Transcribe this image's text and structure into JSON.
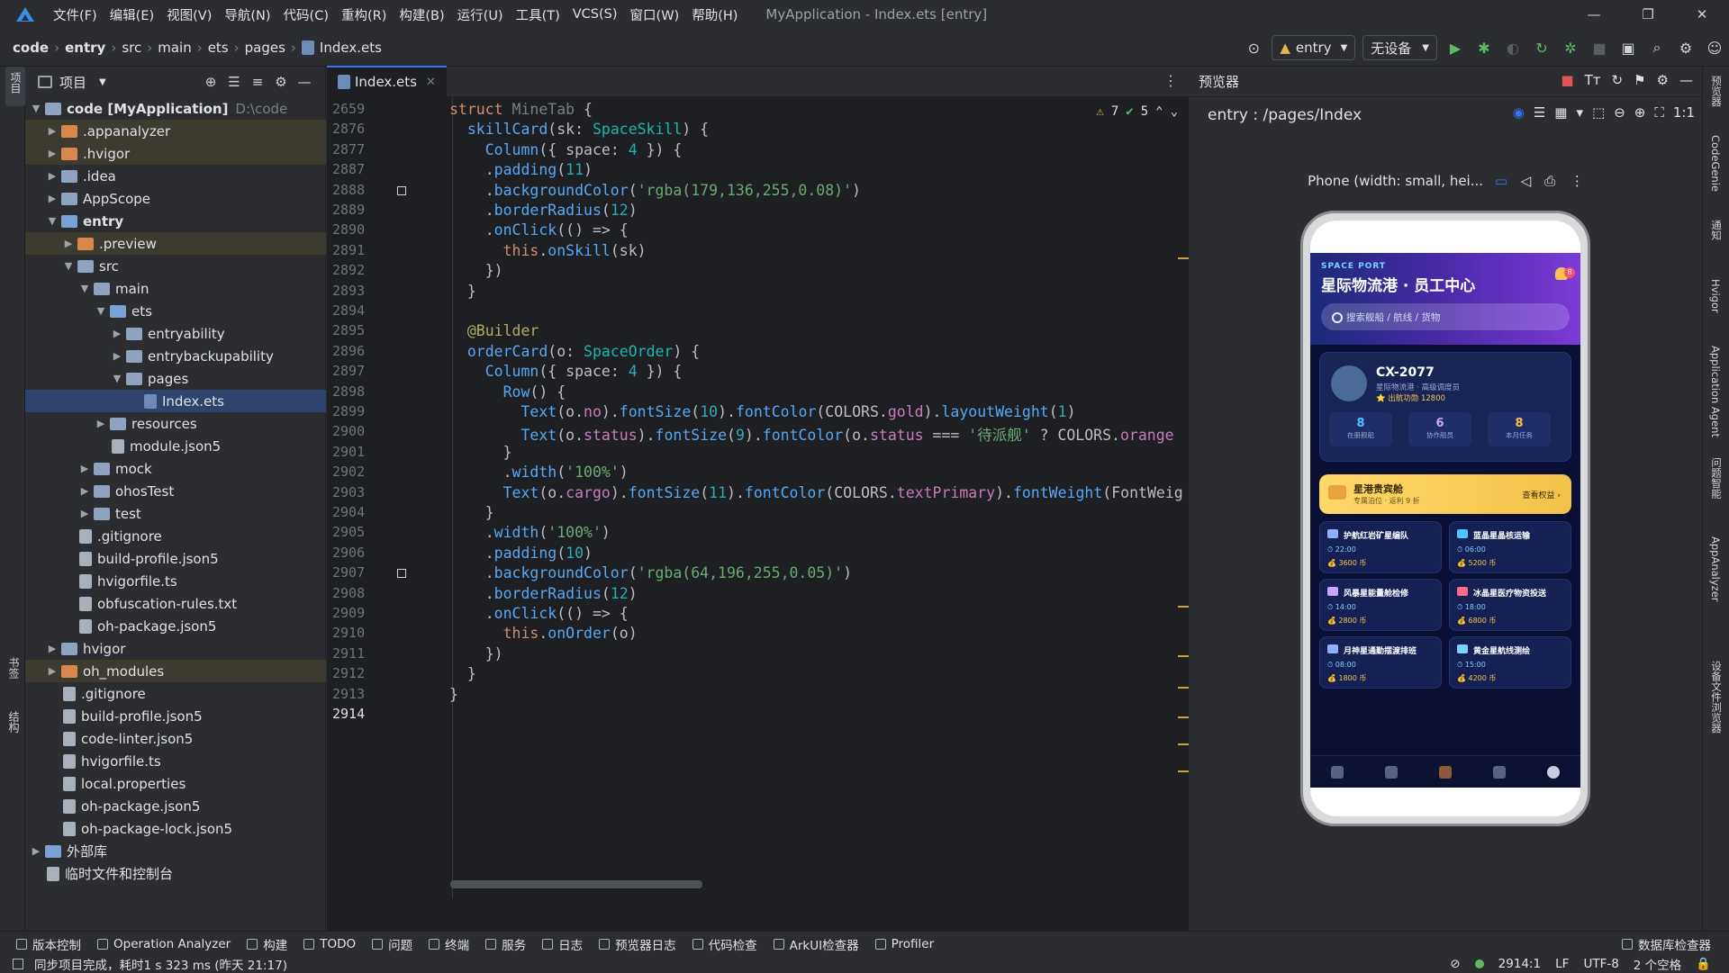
{
  "menubar": {
    "items": [
      "文件(F)",
      "编辑(E)",
      "视图(V)",
      "导航(N)",
      "代码(C)",
      "重构(R)",
      "构建(B)",
      "运行(U)",
      "工具(T)",
      "VCS(S)",
      "窗口(W)",
      "帮助(H)"
    ],
    "window_title": "MyApplication - Index.ets [entry]"
  },
  "breadcrumb": [
    "code",
    "entry",
    "src",
    "main",
    "ets",
    "pages",
    "Index.ets"
  ],
  "toolbar": {
    "module": "entry",
    "device": "无设备"
  },
  "left_tools": {
    "project": "项目",
    "bookmarks": "书签",
    "structure": "结构"
  },
  "project_panel": {
    "title": "项目",
    "tree": [
      {
        "label": "code [MyApplication]",
        "extra": "D:\\code",
        "depth": 0,
        "type": "folder",
        "expanded": true
      },
      {
        "label": ".appanalyzer",
        "depth": 1,
        "type": "folder-orange"
      },
      {
        "label": ".hvigor",
        "depth": 1,
        "type": "folder-orange"
      },
      {
        "label": ".idea",
        "depth": 1,
        "type": "folder"
      },
      {
        "label": "AppScope",
        "depth": 1,
        "type": "folder"
      },
      {
        "label": "entry",
        "depth": 1,
        "type": "folder-blue",
        "expanded": true
      },
      {
        "label": ".preview",
        "depth": 2,
        "type": "folder-orange"
      },
      {
        "label": "src",
        "depth": 2,
        "type": "folder",
        "expanded": true
      },
      {
        "label": "main",
        "depth": 3,
        "type": "folder",
        "expanded": true
      },
      {
        "label": "ets",
        "depth": 4,
        "type": "folder-blue",
        "expanded": true
      },
      {
        "label": "entryability",
        "depth": 5,
        "type": "folder"
      },
      {
        "label": "entrybackupability",
        "depth": 5,
        "type": "folder"
      },
      {
        "label": "pages",
        "depth": 5,
        "type": "folder",
        "expanded": true
      },
      {
        "label": "Index.ets",
        "depth": 6,
        "type": "file-ts",
        "selected": true
      },
      {
        "label": "resources",
        "depth": 4,
        "type": "folder"
      },
      {
        "label": "module.json5",
        "depth": 4,
        "type": "file"
      },
      {
        "label": "mock",
        "depth": 3,
        "type": "folder"
      },
      {
        "label": "ohosTest",
        "depth": 3,
        "type": "folder"
      },
      {
        "label": "test",
        "depth": 3,
        "type": "folder"
      },
      {
        "label": ".gitignore",
        "depth": 2,
        "type": "file"
      },
      {
        "label": "build-profile.json5",
        "depth": 2,
        "type": "file"
      },
      {
        "label": "hvigorfile.ts",
        "depth": 2,
        "type": "file"
      },
      {
        "label": "obfuscation-rules.txt",
        "depth": 2,
        "type": "file"
      },
      {
        "label": "oh-package.json5",
        "depth": 2,
        "type": "file"
      },
      {
        "label": "hvigor",
        "depth": 1,
        "type": "folder"
      },
      {
        "label": "oh_modules",
        "depth": 1,
        "type": "folder-orange"
      },
      {
        "label": ".gitignore",
        "depth": 1,
        "type": "file"
      },
      {
        "label": "build-profile.json5",
        "depth": 1,
        "type": "file"
      },
      {
        "label": "code-linter.json5",
        "depth": 1,
        "type": "file"
      },
      {
        "label": "hvigorfile.ts",
        "depth": 1,
        "type": "file"
      },
      {
        "label": "local.properties",
        "depth": 1,
        "type": "file"
      },
      {
        "label": "oh-package.json5",
        "depth": 1,
        "type": "file"
      },
      {
        "label": "oh-package-lock.json5",
        "depth": 1,
        "type": "file"
      },
      {
        "label": "外部库",
        "depth": 0,
        "type": "lib"
      },
      {
        "label": "临时文件和控制台",
        "depth": 0,
        "type": "scratch"
      }
    ]
  },
  "editor": {
    "tab": "Index.ets",
    "inspections": {
      "warnings": "7",
      "ok": "5"
    },
    "lines": [
      {
        "n": "2659",
        "html": "<span class='k'>struct</span> <span style='color:#7a7e85'>MineTab</span> {"
      },
      {
        "n": "2876",
        "html": "  <span class='f'>skillCard</span>(sk: <span class='t'>SpaceSkill</span>) {"
      },
      {
        "n": "2877",
        "html": "    <span class='f'>Column</span>({ space: <span class='n'>4</span> }) {"
      },
      {
        "n": "2887",
        "html": "    .<span class='f'>padding</span>(<span class='n'>11</span>)"
      },
      {
        "n": "2888",
        "html": "    .<span class='f'>backgroundColor</span>(<span class='s'>'rgba(179,136,255,0.08)'</span>)"
      },
      {
        "n": "2889",
        "html": "    .<span class='f'>borderRadius</span>(<span class='n'>12</span>)"
      },
      {
        "n": "2890",
        "html": "    .<span class='f'>onClick</span>(() => {"
      },
      {
        "n": "2891",
        "html": "      <span class='k'>this</span>.<span class='f'>onSkill</span>(sk)"
      },
      {
        "n": "2892",
        "html": "    })"
      },
      {
        "n": "2893",
        "html": "  }"
      },
      {
        "n": "2894",
        "html": ""
      },
      {
        "n": "2895",
        "html": "  <span class='a'>@Builder</span>"
      },
      {
        "n": "2896",
        "html": "  <span class='f'>orderCard</span>(o: <span class='t'>SpaceOrder</span>) {"
      },
      {
        "n": "2897",
        "html": "    <span class='f'>Column</span>({ space: <span class='n'>4</span> }) {"
      },
      {
        "n": "2898",
        "html": "      <span class='f'>Row</span>() {"
      },
      {
        "n": "2899",
        "html": "        <span class='f'>Text</span>(o.<span class='p'>no</span>).<span class='f'>fontSize</span>(<span class='n'>10</span>).<span class='f'>fontColor</span>(COLORS.<span class='p'>gold</span>).<span class='f'>layoutWeight</span>(<span class='n'>1</span>)"
      },
      {
        "n": "2900",
        "html": "        <span class='f'>Text</span>(o.<span class='p'>status</span>).<span class='f'>fontSize</span>(<span class='n'>9</span>).<span class='f'>fontColor</span>(o.<span class='p'>status</span> === <span class='s'>'待派舰'</span> ? COLORS.<span class='p'>orange</span>"
      },
      {
        "n": "2901",
        "html": "      }"
      },
      {
        "n": "2902",
        "html": "      .<span class='f'>width</span>(<span class='s'>'100%'</span>)"
      },
      {
        "n": "2903",
        "html": "      <span class='f'>Text</span>(o.<span class='p'>cargo</span>).<span class='f'>fontSize</span>(<span class='n'>11</span>).<span class='f'>fontColor</span>(COLORS.<span class='p'>textPrimary</span>).<span class='f'>fontWeight</span>(FontWeig"
      },
      {
        "n": "2904",
        "html": "    }"
      },
      {
        "n": "2905",
        "html": "    .<span class='f'>width</span>(<span class='s'>'100%'</span>)"
      },
      {
        "n": "2906",
        "html": "    .<span class='f'>padding</span>(<span class='n'>10</span>)"
      },
      {
        "n": "2907",
        "html": "    .<span class='f'>backgroundColor</span>(<span class='s'>'rgba(64,196,255,0.05)'</span>)"
      },
      {
        "n": "2908",
        "html": "    .<span class='f'>borderRadius</span>(<span class='n'>12</span>)"
      },
      {
        "n": "2909",
        "html": "    .<span class='f'>onClick</span>(() => {"
      },
      {
        "n": "2910",
        "html": "      <span class='k'>this</span>.<span class='f'>onOrder</span>(o)"
      },
      {
        "n": "2911",
        "html": "    })"
      },
      {
        "n": "2912",
        "html": "  }"
      },
      {
        "n": "2913",
        "html": "}"
      },
      {
        "n": "2914",
        "html": ""
      }
    ]
  },
  "preview": {
    "title": "预览器",
    "path": "entry : /pages/Index",
    "device": "Phone (width: small, hei...",
    "app": {
      "tag": "SPACE PORT",
      "title": "星际物流港 · 员工中心",
      "badge": "8",
      "search_placeholder": "搜索舰船 / 航线 / 货物",
      "user": {
        "name": "CX-2077",
        "role": "星际物流港 · 高级调度员",
        "points": "⭐ 出航功勋 12800"
      },
      "stats": [
        {
          "value": "8",
          "label": "在册舰船",
          "color": "#4fc3ff"
        },
        {
          "value": "6",
          "label": "协作船员",
          "color": "#c9a6ff"
        },
        {
          "value": "8",
          "label": "本月任务",
          "color": "#f5c451"
        }
      ],
      "vip": {
        "title": "星港贵宾舱",
        "sub": "专属泊位 · 返利 9 折",
        "link": "查看权益 ›"
      },
      "orders": [
        {
          "title": "护航红岩矿星编队",
          "time": "⏱ 22:00",
          "price": "💰 3600 币",
          "color": "#8fb0ff"
        },
        {
          "title": "蓝晶星晶核运输",
          "time": "⏱ 06:00",
          "price": "💰 5200 币",
          "color": "#4fc3ff"
        },
        {
          "title": "风暴星能量舱检修",
          "time": "⏱ 14:00",
          "price": "💰 2800 币",
          "color": "#c9a6ff"
        },
        {
          "title": "冰晶星医疗物资投送",
          "time": "⏱ 18:00",
          "price": "💰 6800 币",
          "color": "#ff6b8a"
        },
        {
          "title": "月神星通勤摆渡排班",
          "time": "⏱ 08:00",
          "price": "💰 1800 币",
          "color": "#8fb0ff"
        },
        {
          "title": "黄金星航线测绘",
          "time": "⏱ 15:00",
          "price": "💰 4200 币",
          "color": "#7ad3ff"
        }
      ]
    }
  },
  "right_tools": [
    "预览器",
    "CodeGenie",
    "通知",
    "Hvigor",
    "Application Agent",
    "问题智能",
    "AppAnalyzer",
    "设备文件浏览器"
  ],
  "bottom_tools": [
    "版本控制",
    "Operation Analyzer",
    "构建",
    "TODO",
    "问题",
    "终端",
    "服务",
    "日志",
    "预览器日志",
    "代码检查",
    "ArkUI检查器",
    "Profiler",
    "数据库检查器"
  ],
  "statusbar": {
    "message": "同步项目完成，耗时1 s 323 ms (昨天 21:17)",
    "position": "2914:1",
    "line_sep": "LF",
    "encoding": "UTF-8",
    "indent": "2 个空格"
  }
}
